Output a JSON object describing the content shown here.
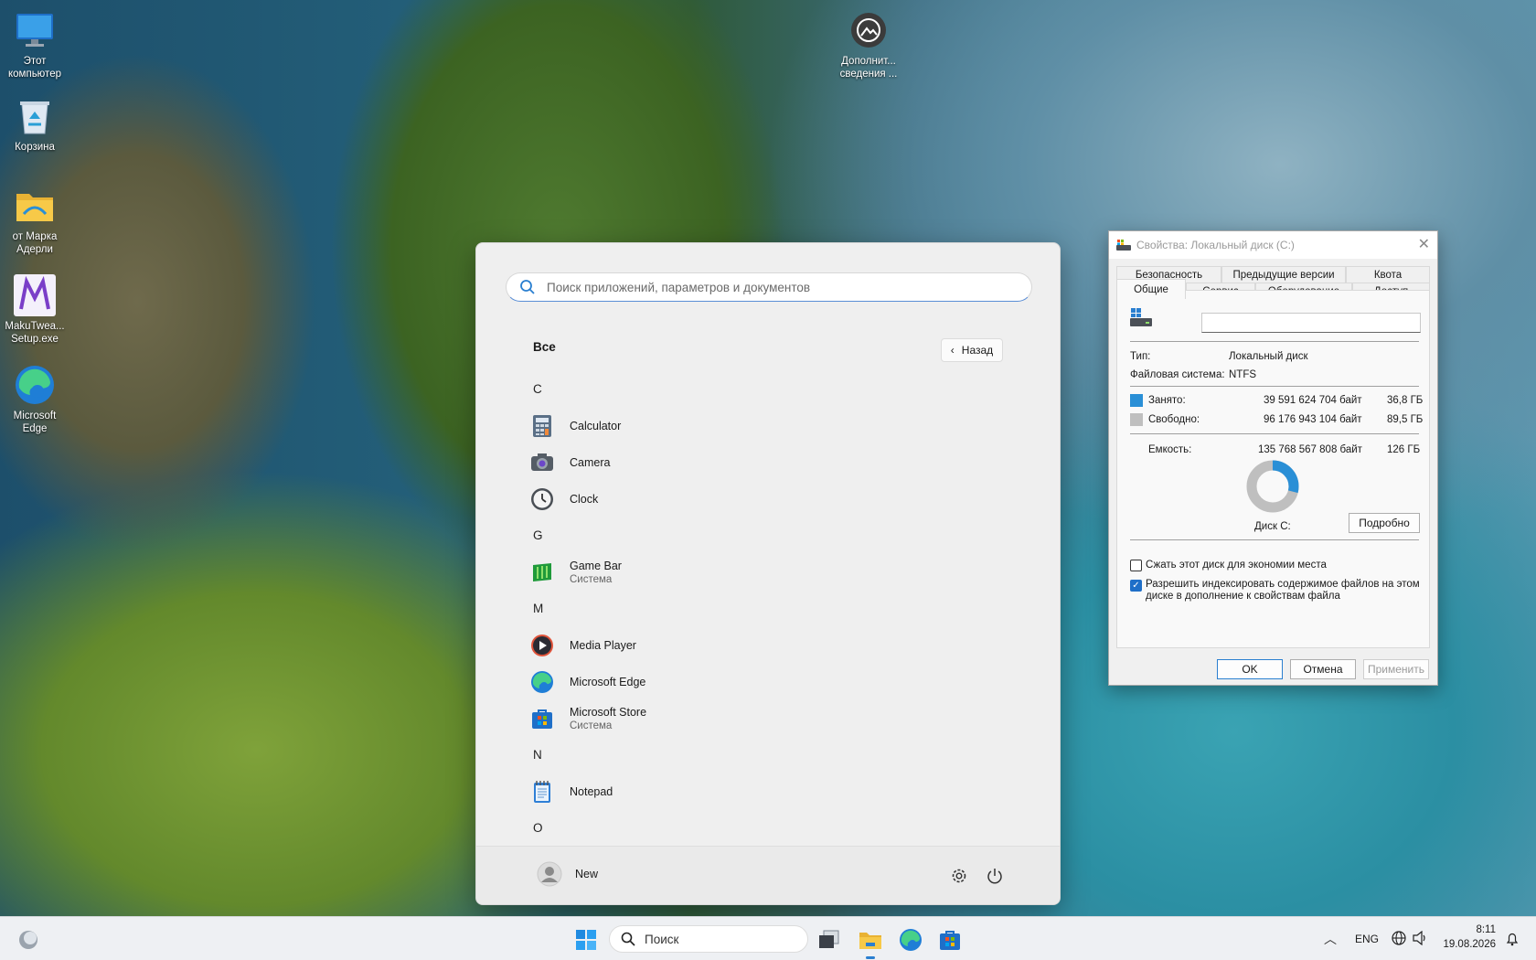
{
  "desktop": {
    "icons": [
      {
        "label": "Этот компьютер"
      },
      {
        "label": "Корзина"
      },
      {
        "label": "от Марка Адерли"
      },
      {
        "label": "MakuTwea... Setup.exe"
      },
      {
        "label": "Microsoft Edge"
      },
      {
        "label": "Дополнит... сведения ..."
      }
    ]
  },
  "start_menu": {
    "search_placeholder": "Поиск приложений, параметров и документов",
    "all_header": "Все",
    "back_label": "Назад",
    "letters": [
      "C",
      "G",
      "M",
      "N",
      "O"
    ],
    "apps": [
      {
        "name": "Calculator",
        "sub": ""
      },
      {
        "name": "Camera",
        "sub": ""
      },
      {
        "name": "Clock",
        "sub": ""
      },
      {
        "name": "Game Bar",
        "sub": "Система"
      },
      {
        "name": "Media Player",
        "sub": ""
      },
      {
        "name": "Microsoft Edge",
        "sub": ""
      },
      {
        "name": "Microsoft Store",
        "sub": "Система"
      },
      {
        "name": "Notepad",
        "sub": ""
      }
    ],
    "user_name": "New"
  },
  "properties": {
    "title": "Свойства: Локальный диск (C:)",
    "tabs_top": [
      "Безопасность",
      "Предыдущие версии",
      "Квота"
    ],
    "tabs_bottom": [
      "Общие",
      "Сервис",
      "Оборудование",
      "Доступ"
    ],
    "active_tab": "Общие",
    "type_label": "Тип:",
    "type_value": "Локальный диск",
    "fs_label": "Файловая система:",
    "fs_value": "NTFS",
    "used_label": "Занято:",
    "used_bytes": "39 591 624 704 байт",
    "used_gb": "36,8 ГБ",
    "free_label": "Свободно:",
    "free_bytes": "96 176 943 104 байт",
    "free_gb": "89,5 ГБ",
    "capacity_label": "Емкость:",
    "capacity_bytes": "135 768 567 808 байт",
    "capacity_gb": "126 ГБ",
    "used_fraction": 0.29,
    "disk_label": "Диск C:",
    "details_button": "Подробно",
    "compress_label": "Сжать этот диск для экономии места",
    "compress_checked": false,
    "index_label_1": "Разрешить индексировать содержимое файлов на этом",
    "index_label_2": "диске в дополнение к свойствам файла",
    "index_checked": true,
    "ok": "OK",
    "cancel": "Отмена",
    "apply": "Применить",
    "colors": {
      "used": "#2a8fd6",
      "free": "#bfbfbf"
    }
  },
  "taskbar": {
    "search_label": "Поиск",
    "lang": "ENG",
    "time": "8:11",
    "date": "19.08.2026"
  }
}
